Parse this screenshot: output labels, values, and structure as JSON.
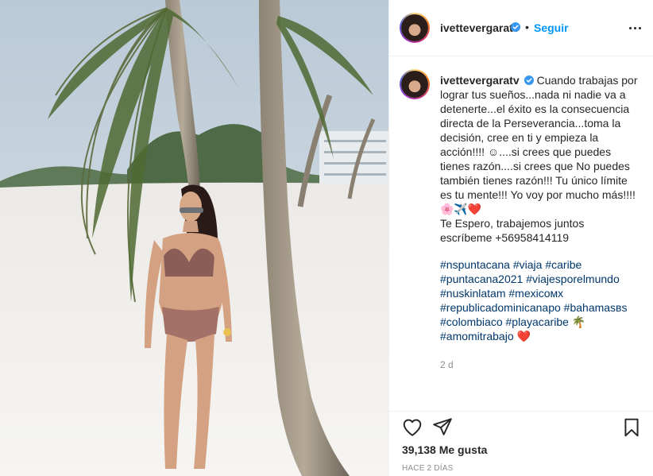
{
  "header": {
    "username": "ivettevergaratv",
    "separator": "•",
    "follow_label": "Seguir"
  },
  "icons": {
    "verified": "verified-badge-icon",
    "more": "more-options-icon",
    "like": "heart-outline-icon",
    "share": "paper-plane-icon",
    "save": "bookmark-icon"
  },
  "caption": {
    "username": "ivettevergaratv",
    "text": "Cuando trabajas por lograr tus sueños...nada ni nadie va a detenerte...el éxito es la consecuencia directa de la Perseverancia...toma la decisión, cree en ti y empieza la acción!!!! ☺....si crees que puedes tienes razón....si crees que No puedes también tienes razón!!! Tu único límite es tu mente!!! Yo voy por mucho más!!!! 🌸✈️❤️\nTe Espero, trabajemos juntos escríbeme +56958414119",
    "hashtags": [
      "#nspuntacana",
      "#viaja",
      "#caribe",
      "#puntacana2021",
      "#viajesporelmundo",
      "#nuskinlatam",
      "#mexicoмх",
      "#republicadominicanapo",
      "#bahamasвs",
      "#colombiaco",
      "#playacaribe 🌴",
      "#amomitrabajo ❤️"
    ],
    "age": "2 d"
  },
  "footer": {
    "likes_label": "39,138 Me gusta",
    "posted_label": "HACE 2 DÍAS"
  },
  "colors": {
    "accent": "#0095f6",
    "hashtag": "#00376b",
    "muted": "#8e8e8e",
    "border": "#efefef"
  }
}
